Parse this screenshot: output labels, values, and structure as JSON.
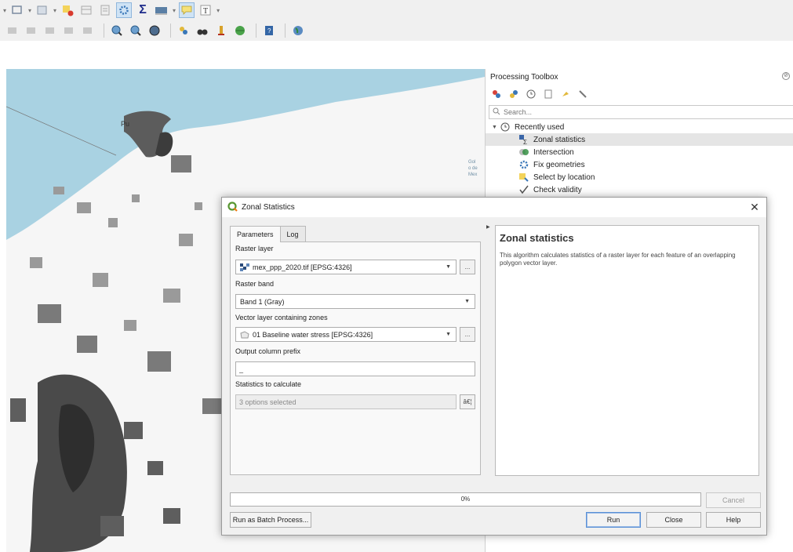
{
  "toolbox": {
    "title": "Processing Toolbox",
    "search_placeholder": "Search...",
    "group_label": "Recently used",
    "items": [
      {
        "label": "Zonal statistics",
        "icon": "zonal-statistics-icon",
        "selected": true
      },
      {
        "label": "Intersection",
        "icon": "intersection-icon"
      },
      {
        "label": "Fix geometries",
        "icon": "fix-geometries-icon"
      },
      {
        "label": "Select by location",
        "icon": "select-by-location-icon"
      },
      {
        "label": "Check validity",
        "icon": "check-validity-icon"
      }
    ]
  },
  "map": {
    "place_label": "Pu",
    "side_labels": [
      "Gol",
      "o de",
      "Mex"
    ]
  },
  "dialog": {
    "title": "Zonal Statistics",
    "tabs": [
      "Parameters",
      "Log"
    ],
    "fields": {
      "raster_layer_label": "Raster layer",
      "raster_layer_value": "mex_ppp_2020.tif [EPSG:4326]",
      "raster_band_label": "Raster band",
      "raster_band_value": "Band 1 (Gray)",
      "vector_layer_label": "Vector layer containing zones",
      "vector_layer_value": "01 Baseline water stress [EPSG:4326]",
      "output_prefix_label": "Output column prefix",
      "output_prefix_value": "_",
      "statistics_label": "Statistics to calculate",
      "statistics_value": "3 options selected",
      "statistics_button": "â€¦",
      "dots_button": "..."
    },
    "help": {
      "title": "Zonal statistics",
      "text": "This algorithm calculates statistics of a raster layer for each feature of an overlapping polygon vector layer."
    },
    "progress_text": "0%",
    "buttons": {
      "cancel": "Cancel",
      "batch": "Run as Batch Process...",
      "run": "Run",
      "close": "Close",
      "help": "Help"
    }
  },
  "colors": {
    "water": "#a9d2e2",
    "selection": "#e5e5e5",
    "dialog_bg": "#f0f0f0",
    "default_button": "#5a90d6"
  }
}
